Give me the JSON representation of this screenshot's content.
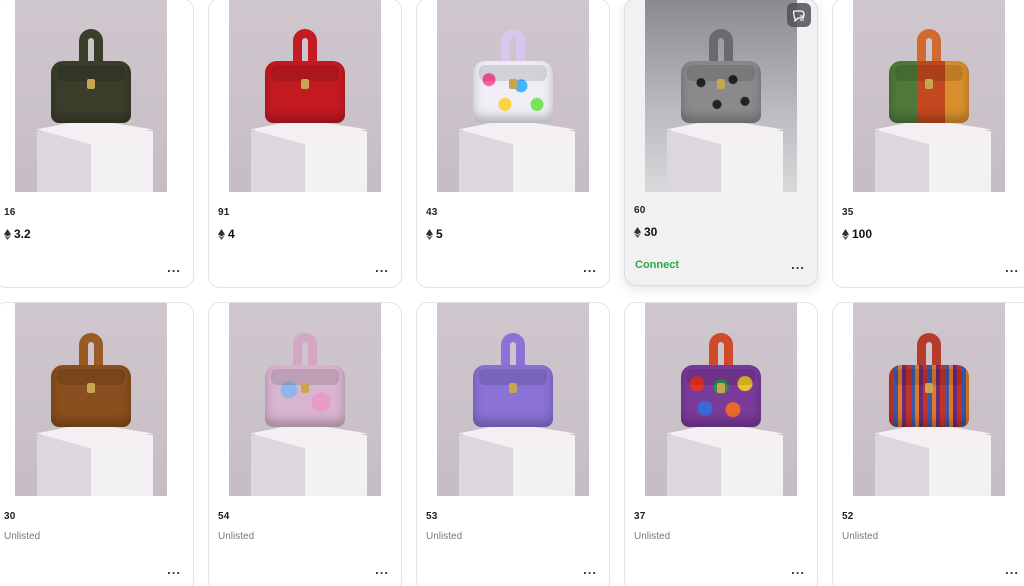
{
  "cards": [
    {
      "id": "16",
      "price": "3.2",
      "listed": true,
      "bag_color": "#3b3e2a",
      "action": "..."
    },
    {
      "id": "91",
      "price": "4",
      "listed": true,
      "bag_color": "#c41a22",
      "action": "..."
    },
    {
      "id": "43",
      "price": "5",
      "listed": true,
      "bag_color": "#e8e6f0",
      "action": "..."
    },
    {
      "id": "60",
      "price": "30",
      "listed": true,
      "bag_color": "#6a6a6c",
      "connect": "Connect",
      "hovered": true,
      "action": "..."
    },
    {
      "id": "35",
      "price": "100",
      "listed": true,
      "bag_color": "#8a5a2a",
      "action": "..."
    },
    {
      "id": "30",
      "status": "Unlisted",
      "listed": false,
      "bag_color": "#8a4f1e",
      "action": "..."
    },
    {
      "id": "54",
      "status": "Unlisted",
      "listed": false,
      "bag_color": "#c89ab6",
      "action": "..."
    },
    {
      "id": "53",
      "status": "Unlisted",
      "listed": false,
      "bag_color": "#8a72d6",
      "action": "..."
    },
    {
      "id": "37",
      "status": "Unlisted",
      "listed": false,
      "bag_color": "#b8452c",
      "action": "..."
    },
    {
      "id": "52",
      "status": "Unlisted",
      "listed": false,
      "bag_color": "#a4362a",
      "action": "..."
    }
  ],
  "icons": {
    "currency": "ethereum-icon",
    "overflow": "more-options-icon",
    "corner": "chat-icon"
  },
  "accent": "#2aa84a"
}
